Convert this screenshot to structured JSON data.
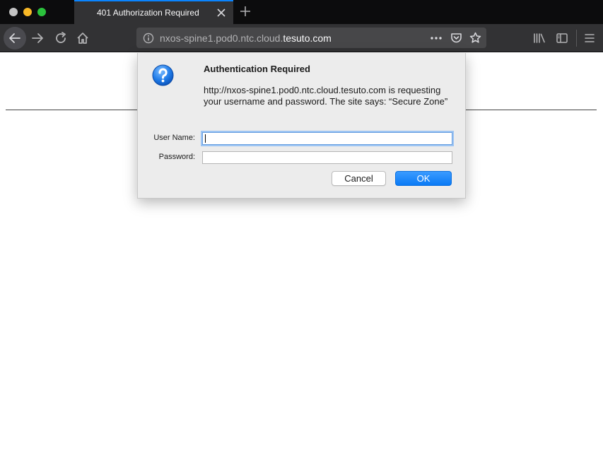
{
  "browser": {
    "tab": {
      "title": "401 Authorization Required"
    },
    "url": {
      "prefix": "nxos-spine1.pod0.ntc.cloud.",
      "domain": "tesuto.com"
    },
    "icons": {
      "window_controls": [
        "close-dot",
        "minimize-dot",
        "maximize-dot"
      ],
      "toolbar": [
        "back-arrow-icon",
        "forward-arrow-icon",
        "reload-icon",
        "home-icon",
        "info-icon",
        "more-icon",
        "pocket-icon",
        "star-icon",
        "library-icon",
        "sidebar-icon",
        "hamburger-menu-icon"
      ]
    }
  },
  "dialog": {
    "title": "Authentication Required",
    "message": "http://nxos-spine1.pod0.ntc.cloud.tesuto.com is requesting your username and password. The site says: “Secure Zone”",
    "username_label": "User Name:",
    "username_value": "",
    "password_label": "Password:",
    "password_value": "",
    "cancel_label": "Cancel",
    "ok_label": "OK",
    "icon": "question-icon"
  },
  "colors": {
    "accent": "#0a84ff",
    "toolbar": "#323234",
    "tabbar": "#0c0c0d",
    "ok_button": "#0a7af5"
  }
}
